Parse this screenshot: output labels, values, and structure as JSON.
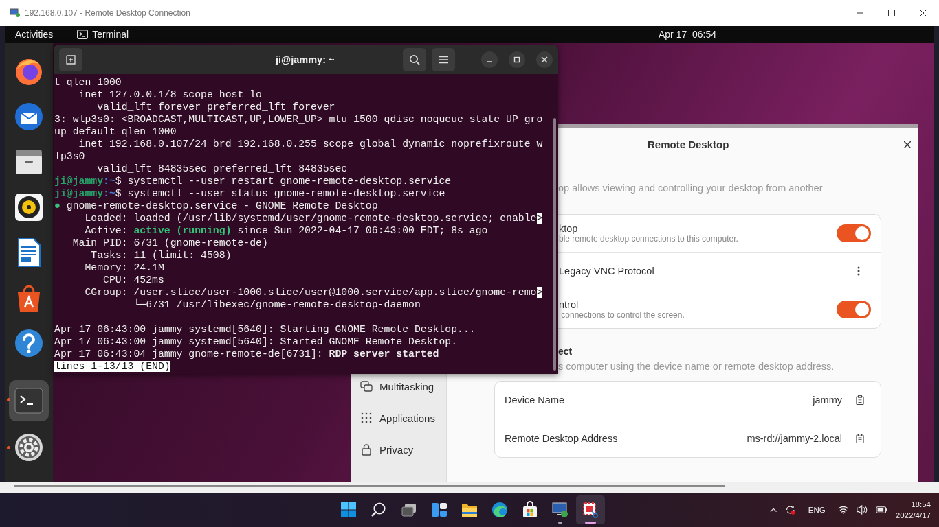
{
  "rdp_window": {
    "title": "192.168.0.107 - Remote Desktop Connection"
  },
  "top_bar": {
    "activities": "Activities",
    "app": "Terminal",
    "clock": "Apr 17  06:54"
  },
  "dock": {
    "items": [
      {
        "running": false,
        "selected": false
      },
      {
        "running": false,
        "selected": false
      },
      {
        "running": false,
        "selected": false
      },
      {
        "running": false,
        "selected": false
      },
      {
        "running": false,
        "selected": false
      },
      {
        "running": false,
        "selected": false
      },
      {
        "running": false,
        "selected": false
      },
      {
        "running": true,
        "selected": true
      },
      {
        "running": true,
        "selected": false
      }
    ]
  },
  "terminal": {
    "title": "ji@jammy: ~",
    "lines": [
      {
        "kind": "plain",
        "text": "t qlen 1000"
      },
      {
        "kind": "plain",
        "text": "    inet 127.0.0.1/8 scope host lo"
      },
      {
        "kind": "plain",
        "text": "       valid_lft forever preferred_lft forever"
      },
      {
        "kind": "plain",
        "text": "3: wlp3s0: <BROADCAST,MULTICAST,UP,LOWER_UP> mtu 1500 qdisc noqueue state UP gro"
      },
      {
        "kind": "plain",
        "text": "up default qlen 1000"
      },
      {
        "kind": "plain",
        "text": "    inet 192.168.0.107/24 brd 192.168.0.255 scope global dynamic noprefixroute w"
      },
      {
        "kind": "plain",
        "text": "lp3s0"
      },
      {
        "kind": "plain",
        "text": "       valid_lft 84835sec preferred_lft 84835sec"
      },
      {
        "kind": "styled",
        "segments": [
          {
            "text": "ji@jammy",
            "kind": "user"
          },
          {
            "text": ":~",
            "kind": "path"
          },
          {
            "text": "$ systemctl --user restart gnome-remote-desktop.service",
            "kind": "plain"
          }
        ]
      },
      {
        "kind": "styled",
        "segments": [
          {
            "text": "ji@jammy",
            "kind": "user"
          },
          {
            "text": ":~",
            "kind": "path"
          },
          {
            "text": "$ systemctl --user status gnome-remote-desktop.service",
            "kind": "plain"
          }
        ]
      },
      {
        "kind": "styled",
        "segments": [
          {
            "text": "●",
            "kind": "dot"
          },
          {
            "text": " gnome-remote-desktop.service - GNOME Remote Desktop",
            "kind": "plain"
          }
        ]
      },
      {
        "kind": "styled",
        "segments": [
          {
            "text": "     Loaded: loaded (/usr/lib/systemd/user/gnome-remote-desktop.service; enable",
            "kind": "plain"
          },
          {
            "text": ">",
            "kind": "inverse"
          }
        ]
      },
      {
        "kind": "styled",
        "segments": [
          {
            "text": "     Active: ",
            "kind": "plain"
          },
          {
            "text": "active (running)",
            "kind": "active"
          },
          {
            "text": " since Sun 2022-04-17 06:43:00 EDT; 8s ago",
            "kind": "plain"
          }
        ]
      },
      {
        "kind": "plain",
        "text": "   Main PID: 6731 (gnome-remote-de)"
      },
      {
        "kind": "plain",
        "text": "      Tasks: 11 (limit: 4508)"
      },
      {
        "kind": "plain",
        "text": "     Memory: 24.1M"
      },
      {
        "kind": "plain",
        "text": "        CPU: 452ms"
      },
      {
        "kind": "styled",
        "segments": [
          {
            "text": "     CGroup: /user.slice/user-1000.slice/user@1000.service/app.slice/gnome-remo",
            "kind": "plain"
          },
          {
            "text": ">",
            "kind": "inverse"
          }
        ]
      },
      {
        "kind": "plain",
        "text": "             └─6731 /usr/libexec/gnome-remote-desktop-daemon"
      },
      {
        "kind": "blank"
      },
      {
        "kind": "plain",
        "text": "Apr 17 06:43:00 jammy systemd[5640]: Starting GNOME Remote Desktop..."
      },
      {
        "kind": "plain",
        "text": "Apr 17 06:43:00 jammy systemd[5640]: Started GNOME Remote Desktop."
      },
      {
        "kind": "styled",
        "segments": [
          {
            "text": "Apr 17 06:43:04 jammy gnome-remote-de[6731]: ",
            "kind": "plain"
          },
          {
            "text": "RDP server started",
            "kind": "bold"
          }
        ]
      },
      {
        "kind": "pager",
        "text": "lines 1-13/13 (END)"
      }
    ]
  },
  "settings": {
    "title": "Remote Desktop",
    "sidebar": [
      {
        "label": "Multitasking"
      },
      {
        "label": "Applications"
      },
      {
        "label": "Privacy"
      }
    ],
    "description": "op allows viewing and controlling your desktop from another",
    "sharing_rows": [
      {
        "kind": "toggle",
        "title": "ktop",
        "subtitle": "ble remote desktop connections to this computer.",
        "on": true
      },
      {
        "kind": "menu",
        "title": "Legacy VNC Protocol"
      },
      {
        "kind": "toggle",
        "title": "ntrol",
        "subtitle": " connections to control the screen.",
        "on": true
      }
    ],
    "connect_heading": "ect",
    "connect_description": "s computer using the device name or remote desktop address.",
    "connect_rows": [
      {
        "label": "Device Name",
        "value": "jammy"
      },
      {
        "label": "Remote Desktop Address",
        "value": "ms-rd://jammy-2.local"
      }
    ]
  },
  "taskbar": {
    "apps": [
      {
        "running": false,
        "selected": false
      },
      {
        "running": false,
        "selected": false
      },
      {
        "running": false,
        "selected": false
      },
      {
        "running": false,
        "selected": false
      },
      {
        "running": false,
        "selected": false
      },
      {
        "running": false,
        "selected": false
      },
      {
        "running": false,
        "selected": false
      },
      {
        "running": true,
        "selected": false
      },
      {
        "running": true,
        "selected": true
      }
    ],
    "language": "ENG",
    "time": "18:54",
    "date": "2022/4/17"
  }
}
